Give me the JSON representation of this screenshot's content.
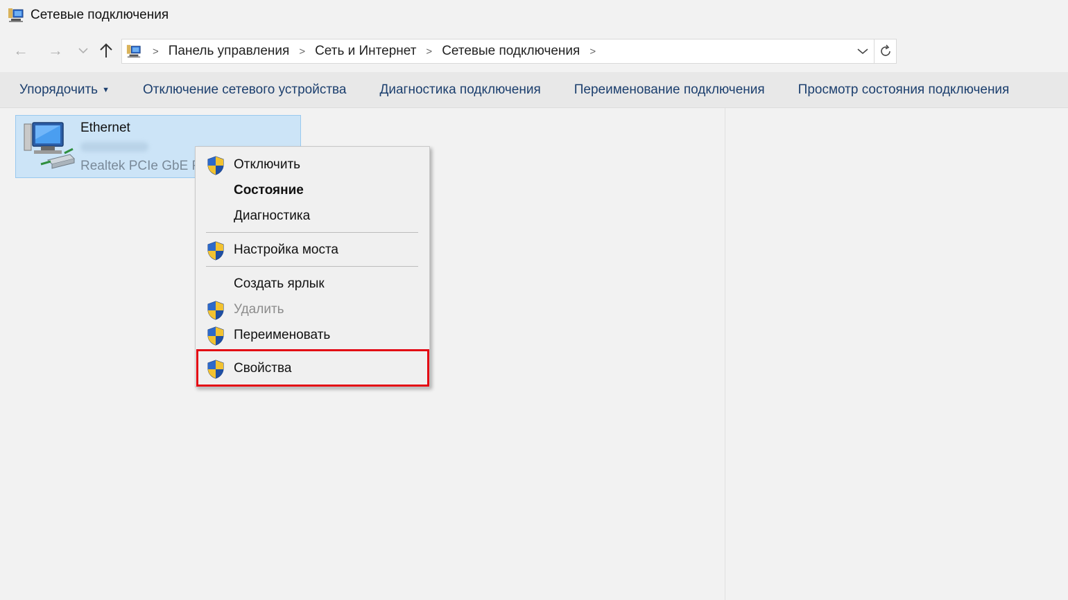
{
  "window": {
    "title": "Сетевые подключения"
  },
  "navigation": {
    "breadcrumbs": [
      "Панель управления",
      "Сеть и Интернет",
      "Сетевые подключения"
    ]
  },
  "toolbar": {
    "organize": "Упорядочить",
    "disable_device": "Отключение сетевого устройства",
    "diagnose": "Диагностика подключения",
    "rename": "Переименование подключения",
    "view_status": "Просмотр состояния подключения"
  },
  "connection": {
    "name": "Ethernet",
    "adapter": "Realtek PCIe GbE Fa"
  },
  "context_menu": {
    "items": [
      {
        "label": "Отключить",
        "shield": true,
        "bold": false,
        "disabled": false
      },
      {
        "label": "Состояние",
        "shield": false,
        "bold": true,
        "disabled": false
      },
      {
        "label": "Диагностика",
        "shield": false,
        "bold": false,
        "disabled": false
      },
      {
        "label": "Настройка моста",
        "shield": true,
        "bold": false,
        "disabled": false
      },
      {
        "label": "Создать ярлык",
        "shield": false,
        "bold": false,
        "disabled": false
      },
      {
        "label": "Удалить",
        "shield": true,
        "bold": false,
        "disabled": true
      },
      {
        "label": "Переименовать",
        "shield": true,
        "bold": false,
        "disabled": false
      },
      {
        "label": "Свойства",
        "shield": true,
        "bold": false,
        "disabled": false,
        "highlighted": true
      }
    ]
  },
  "colors": {
    "highlight_border": "#e30613",
    "selection_fill": "#cce4f7",
    "link_text": "#1c3f6e"
  }
}
